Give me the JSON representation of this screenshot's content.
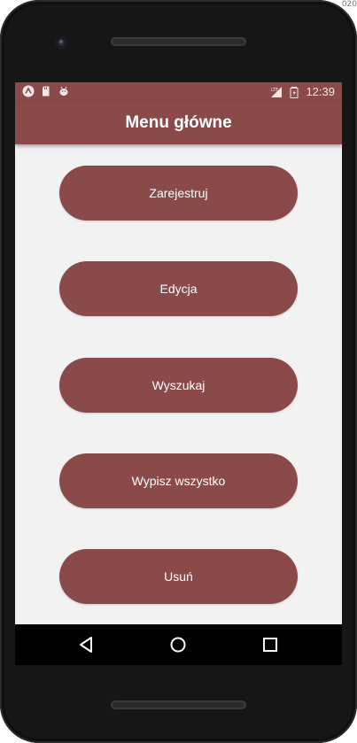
{
  "frame": {
    "corner_text": "020"
  },
  "status_bar": {
    "time": "12:39",
    "left_icons": [
      "app-launcher-icon",
      "sd-card-icon",
      "android-debug-icon"
    ],
    "right_icons": [
      "lte-signal-icon",
      "battery-icon"
    ]
  },
  "app_bar": {
    "title": "Menu główne"
  },
  "menu": {
    "buttons": [
      {
        "label": "Zarejestruj"
      },
      {
        "label": "Edycja"
      },
      {
        "label": "Wyszukaj"
      },
      {
        "label": "Wypisz wszystko"
      },
      {
        "label": "Usuń"
      }
    ]
  },
  "nav_bar": {
    "icons": [
      "back-icon",
      "home-icon",
      "recents-icon"
    ]
  },
  "colors": {
    "accent": "#8b4a4a",
    "background": "#f2f2f2",
    "text_on_accent": "#ffffff"
  }
}
